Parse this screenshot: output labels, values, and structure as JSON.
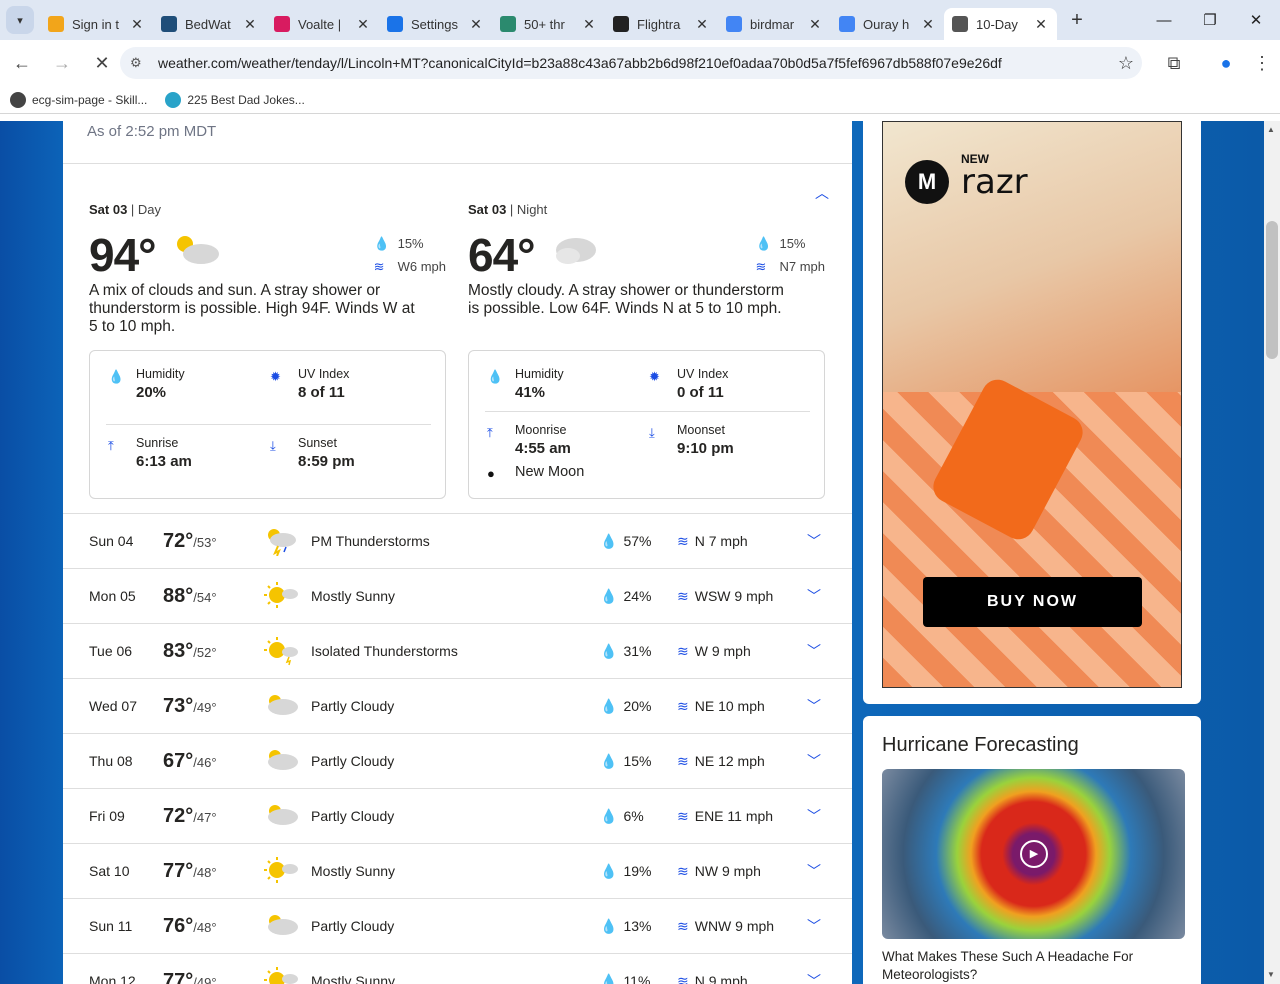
{
  "browser": {
    "tabs": [
      {
        "label": "Sign in t",
        "color": "#f2a51a"
      },
      {
        "label": "BedWat",
        "color": "#1f4e79"
      },
      {
        "label": "Voalte |",
        "color": "#d81b60"
      },
      {
        "label": "Settings",
        "color": "#1a73e8"
      },
      {
        "label": "50+ thr",
        "color": "#2b8a6e"
      },
      {
        "label": "Flightra",
        "color": "#222222"
      },
      {
        "label": "birdmar",
        "color": "#4285f4"
      },
      {
        "label": "Ouray h",
        "color": "#4285f4"
      },
      {
        "label": "10-Day",
        "color": "#555555"
      }
    ],
    "url": "weather.com/weather/tenday/l/Lincoln+MT?canonicalCityId=b23a88c43a67abb2b6d98f210ef0adaa70b0d5a7f5fef6967db588f07e9e26df",
    "bookmarks": [
      "ecg-sim-page - Skill...",
      "225 Best Dad Jokes..."
    ]
  },
  "forecast": {
    "as_of": "As of 2:52 pm MDT",
    "day": {
      "date": "Sat 03",
      "period": "Day",
      "temp": "94°",
      "precip": "15%",
      "wind": "W6 mph",
      "narrative": "A mix of clouds and sun. A stray shower or thunderstorm is possible. High 94F. Winds W at 5 to 10 mph.",
      "humidity_label": "Humidity",
      "humidity": "20%",
      "uv_label": "UV Index",
      "uv": "8 of 11",
      "sunrise_label": "Sunrise",
      "sunrise": "6:13 am",
      "sunset_label": "Sunset",
      "sunset": "8:59 pm"
    },
    "night": {
      "date": "Sat 03",
      "period": "Night",
      "temp": "64°",
      "precip": "15%",
      "wind": "N7 mph",
      "narrative": "Mostly cloudy. A stray shower or thunderstorm is possible. Low 64F. Winds N at 5 to 10 mph.",
      "humidity_label": "Humidity",
      "humidity": "41%",
      "uv_label": "UV Index",
      "uv": "0 of 11",
      "moonrise_label": "Moonrise",
      "moonrise": "4:55 am",
      "moonset_label": "Moonset",
      "moonset": "9:10 pm",
      "moon_phase": "New Moon"
    },
    "days": [
      {
        "day": "Sun 04",
        "hi": "72°",
        "lo": "/53°",
        "cond": "PM Thunderstorms",
        "precip": "57%",
        "wind": "N 7 mph",
        "icon": "thunderstorm-icon"
      },
      {
        "day": "Mon 05",
        "hi": "88°",
        "lo": "/54°",
        "cond": "Mostly Sunny",
        "precip": "24%",
        "wind": "WSW 9 mph",
        "icon": "mostly-sunny-icon"
      },
      {
        "day": "Tue 06",
        "hi": "83°",
        "lo": "/52°",
        "cond": "Isolated Thunderstorms",
        "precip": "31%",
        "wind": "W 9 mph",
        "icon": "isolated-thunderstorms-icon"
      },
      {
        "day": "Wed 07",
        "hi": "73°",
        "lo": "/49°",
        "cond": "Partly Cloudy",
        "precip": "20%",
        "wind": "NE 10 mph",
        "icon": "partly-cloudy-icon"
      },
      {
        "day": "Thu 08",
        "hi": "67°",
        "lo": "/46°",
        "cond": "Partly Cloudy",
        "precip": "15%",
        "wind": "NE 12 mph",
        "icon": "partly-cloudy-icon"
      },
      {
        "day": "Fri 09",
        "hi": "72°",
        "lo": "/47°",
        "cond": "Partly Cloudy",
        "precip": "6%",
        "wind": "ENE 11 mph",
        "icon": "partly-cloudy-icon"
      },
      {
        "day": "Sat 10",
        "hi": "77°",
        "lo": "/48°",
        "cond": "Mostly Sunny",
        "precip": "19%",
        "wind": "NW 9 mph",
        "icon": "mostly-sunny-icon"
      },
      {
        "day": "Sun 11",
        "hi": "76°",
        "lo": "/48°",
        "cond": "Partly Cloudy",
        "precip": "13%",
        "wind": "WNW 9 mph",
        "icon": "partly-cloudy-icon"
      },
      {
        "day": "Mon 12",
        "hi": "77°",
        "lo": "/49°",
        "cond": "Mostly Sunny",
        "precip": "11%",
        "wind": "N 9 mph",
        "icon": "mostly-sunny-icon"
      }
    ]
  },
  "ad": {
    "new": "NEW",
    "brand": "razr",
    "cta": "BUY NOW"
  },
  "hurricane": {
    "title": "Hurricane Forecasting",
    "caption": "What Makes These Such A Headache For Meteorologists?"
  },
  "colors": {
    "accent": "#1b4de4",
    "page_bg": "#0f6fc4"
  }
}
